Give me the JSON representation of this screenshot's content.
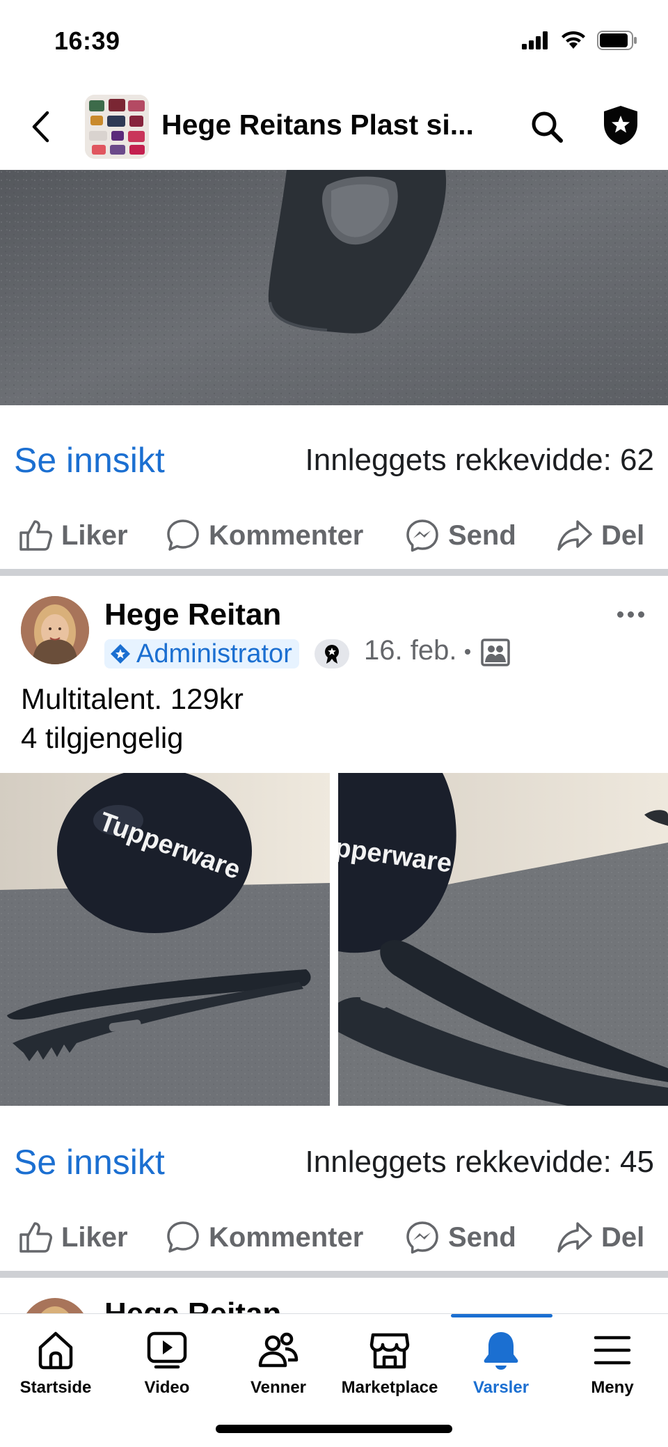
{
  "status_bar": {
    "time": "16:39",
    "icons": [
      "cellular-signal-icon",
      "wifi-icon",
      "battery-icon"
    ]
  },
  "header": {
    "title": "Hege Reitans Plast si...",
    "icons": [
      "back-chevron-icon",
      "group-thumbnail",
      "search-icon",
      "admin-shield-icon"
    ]
  },
  "post1": {
    "insight_label": "Se innsikt",
    "reach": "Innleggets rekkevidde: 62",
    "actions": {
      "like": "Liker",
      "comment": "Kommenter",
      "send": "Send",
      "share": "Del"
    }
  },
  "post2": {
    "author": "Hege Reitan",
    "role_badge": "Administrator",
    "date": "16. feb.",
    "text_line1": "Multitalent. 129kr",
    "text_line2": "4 tilgjengelig",
    "photo_brand_left": "Tupperware",
    "photo_brand_right": "pperware",
    "insight_label": "Se innsikt",
    "reach": "Innleggets rekkevidde: 45",
    "actions": {
      "like": "Liker",
      "comment": "Kommenter",
      "send": "Send",
      "share": "Del"
    }
  },
  "post3": {
    "author": "Hege Reitan"
  },
  "bottom_nav": {
    "items": [
      {
        "label": "Startside",
        "icon": "home-icon"
      },
      {
        "label": "Video",
        "icon": "video-icon"
      },
      {
        "label": "Venner",
        "icon": "friends-icon"
      },
      {
        "label": "Marketplace",
        "icon": "marketplace-icon"
      },
      {
        "label": "Varsler",
        "icon": "bell-icon",
        "active": true
      },
      {
        "label": "Meny",
        "icon": "menu-icon"
      }
    ]
  },
  "colors": {
    "link_blue": "#1b6fd1",
    "secondary_text": "#65676b",
    "divider": "#ced0d4",
    "admin_badge_bg": "#e7f3ff"
  }
}
